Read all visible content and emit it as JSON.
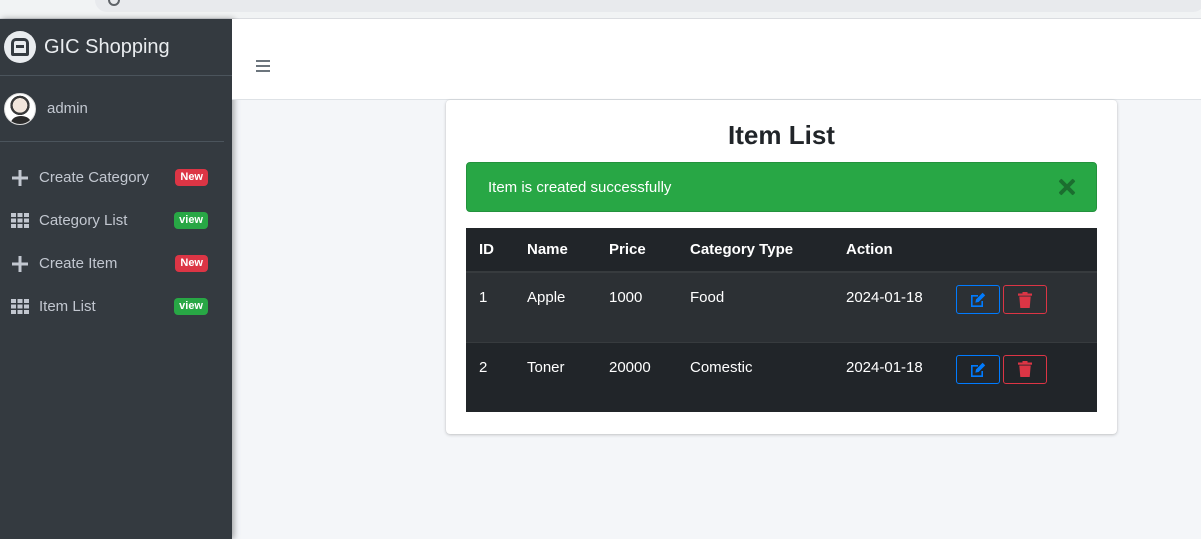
{
  "brand": {
    "name": "GIC Shopping",
    "logo_icon": "brand-logo-icon"
  },
  "user": {
    "name": "admin"
  },
  "sidebar": {
    "items": [
      {
        "label": "Create Category",
        "icon": "plus-icon",
        "badge": "New",
        "badge_color": "#dc3545"
      },
      {
        "label": "Category List",
        "icon": "grid-icon",
        "badge": "view",
        "badge_color": "#28a745"
      },
      {
        "label": "Create Item",
        "icon": "plus-icon",
        "badge": "New",
        "badge_color": "#dc3545"
      },
      {
        "label": "Item List",
        "icon": "grid-icon",
        "badge": "view",
        "badge_color": "#28a745"
      }
    ]
  },
  "topbar": {
    "menu_icon": "hamburger-icon"
  },
  "main": {
    "title": "Item List",
    "alert": {
      "message": "Item is created successfully",
      "color": "#28a745"
    },
    "table": {
      "headers": [
        "ID",
        "Name",
        "Price",
        "Category Type",
        "Action"
      ],
      "rows": [
        {
          "id": "1",
          "name": "Apple",
          "price": "1000",
          "category": "Food",
          "date": "2024-01-18"
        },
        {
          "id": "2",
          "name": "Toner",
          "price": "20000",
          "category": "Comestic",
          "date": "2024-01-18"
        }
      ]
    }
  },
  "colors": {
    "sidebar_bg": "#343a40",
    "table_bg": "#212529",
    "edit": "#007bff",
    "delete": "#dc3545"
  }
}
